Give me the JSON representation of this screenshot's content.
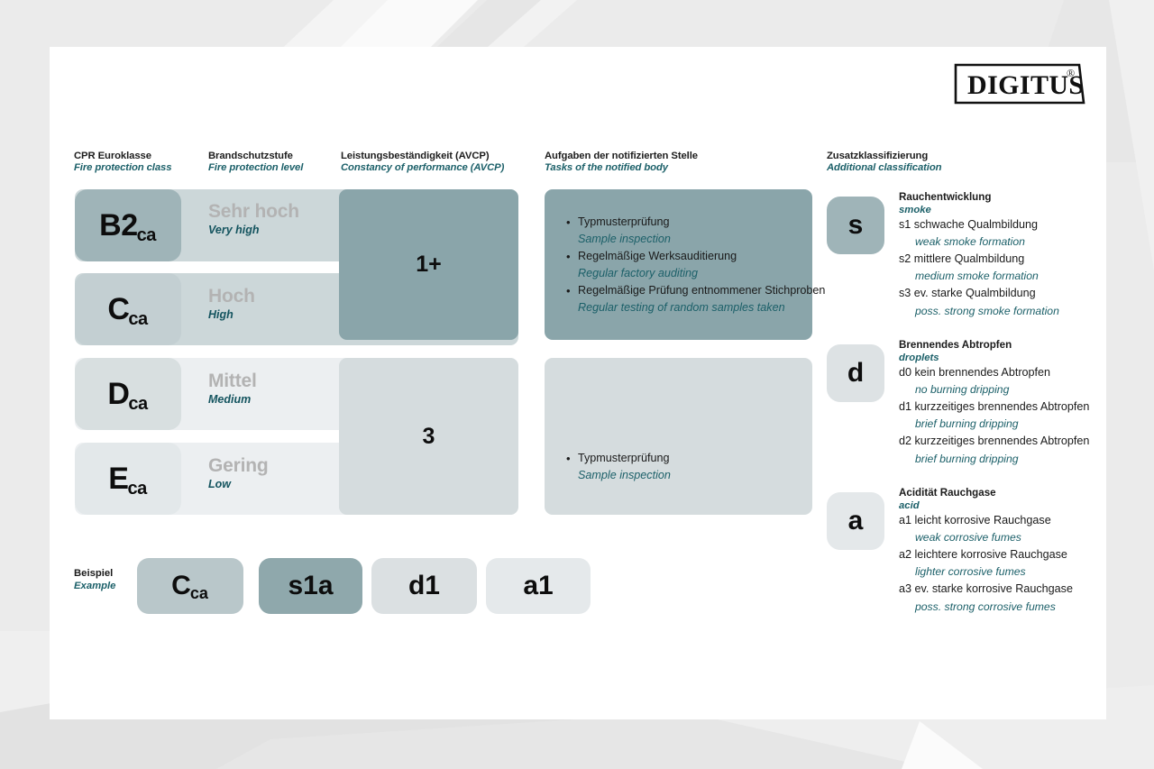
{
  "brand": {
    "logo_text": "DIGITUS",
    "logo_mark": "®"
  },
  "colors": {
    "accent_dark": "#9fb4b8",
    "accent_mid": "#c3cfd2",
    "accent_light": "#d8dfe0",
    "accent_lighter": "#e3e8ea",
    "strip_dark": "#ccd7d9",
    "strip_light": "#eceff1",
    "teal_text": "#1c6069",
    "grey_text": "#b3b3b3",
    "page_bg": "#ebebeb",
    "card_bg": "#ffffff"
  },
  "headers": [
    {
      "de": "CPR Euroklasse",
      "en": "Fire protection class"
    },
    {
      "de": "Brandschutzstufe",
      "en": "Fire protection level"
    },
    {
      "de": "Leistungsbeständigkeit (AVCP)",
      "en": "Constancy of performance (AVCP)"
    },
    {
      "de": "Aufgaben der notifizierten Stelle",
      "en": "Tasks of the notified body"
    },
    {
      "de": "Zusatzklassifizierung",
      "en": "Additional classification"
    }
  ],
  "classes": [
    {
      "code": "B2",
      "sub": "ca",
      "level_de": "Sehr hoch",
      "level_en": "Very high"
    },
    {
      "code": "C",
      "sub": "ca",
      "level_de": "Hoch",
      "level_en": "High"
    },
    {
      "code": "D",
      "sub": "ca",
      "level_de": "Mittel",
      "level_en": "Medium"
    },
    {
      "code": "E",
      "sub": "ca",
      "level_de": "Gering",
      "level_en": "Low"
    }
  ],
  "avcp": [
    {
      "value": "1+"
    },
    {
      "value": "3"
    }
  ],
  "notified_body": [
    {
      "tasks": [
        {
          "de": "Typmusterprüfung",
          "en": "Sample inspection"
        },
        {
          "de": "Regelmäßige Werksauditierung",
          "en": "Regular factory auditing"
        },
        {
          "de": "Regelmäßige Prüfung entnommener Stichproben",
          "en": "Regular testing of random samples taken"
        }
      ]
    },
    {
      "tasks": [
        {
          "de": "Typmusterprüfung",
          "en": "Sample inspection"
        }
      ]
    }
  ],
  "additional": [
    {
      "badge": "s",
      "title_de": "Rauchentwicklung",
      "title_en": "smoke",
      "items": [
        {
          "de": "s1 schwache Qualmbildung",
          "en": "weak smoke formation"
        },
        {
          "de": "s2 mittlere Qualmbildung",
          "en": "medium smoke formation"
        },
        {
          "de": "s3 ev. starke Qualmbildung",
          "en": "poss. strong smoke formation"
        }
      ]
    },
    {
      "badge": "d",
      "title_de": "Brennendes Abtropfen",
      "title_en": "droplets",
      "items": [
        {
          "de": "d0 kein brennendes Abtropfen",
          "en": "no burning dripping"
        },
        {
          "de": "d1 kurzzeitiges brennendes Abtropfen",
          "en": "brief burning dripping"
        },
        {
          "de": "d2 kurzzeitiges brennendes Abtropfen",
          "en": "brief burning dripping"
        }
      ]
    },
    {
      "badge": "a",
      "title_de": "Acidität Rauchgase",
      "title_en": "acid",
      "items": [
        {
          "de": "a1 leicht korrosive Rauchgase",
          "en": "weak corrosive fumes"
        },
        {
          "de": "a2 leichtere korrosive Rauchgase",
          "en": "lighter corrosive fumes"
        },
        {
          "de": "a3 ev. starke korrosive Rauchgase",
          "en": "poss. strong corrosive fumes"
        }
      ]
    }
  ],
  "example": {
    "label_de": "Beispiel",
    "label_en": "Example",
    "boxes": [
      {
        "code": "C",
        "sub": "ca"
      },
      {
        "code": "s1a",
        "sub": ""
      },
      {
        "code": "d1",
        "sub": ""
      },
      {
        "code": "a1",
        "sub": ""
      }
    ]
  }
}
